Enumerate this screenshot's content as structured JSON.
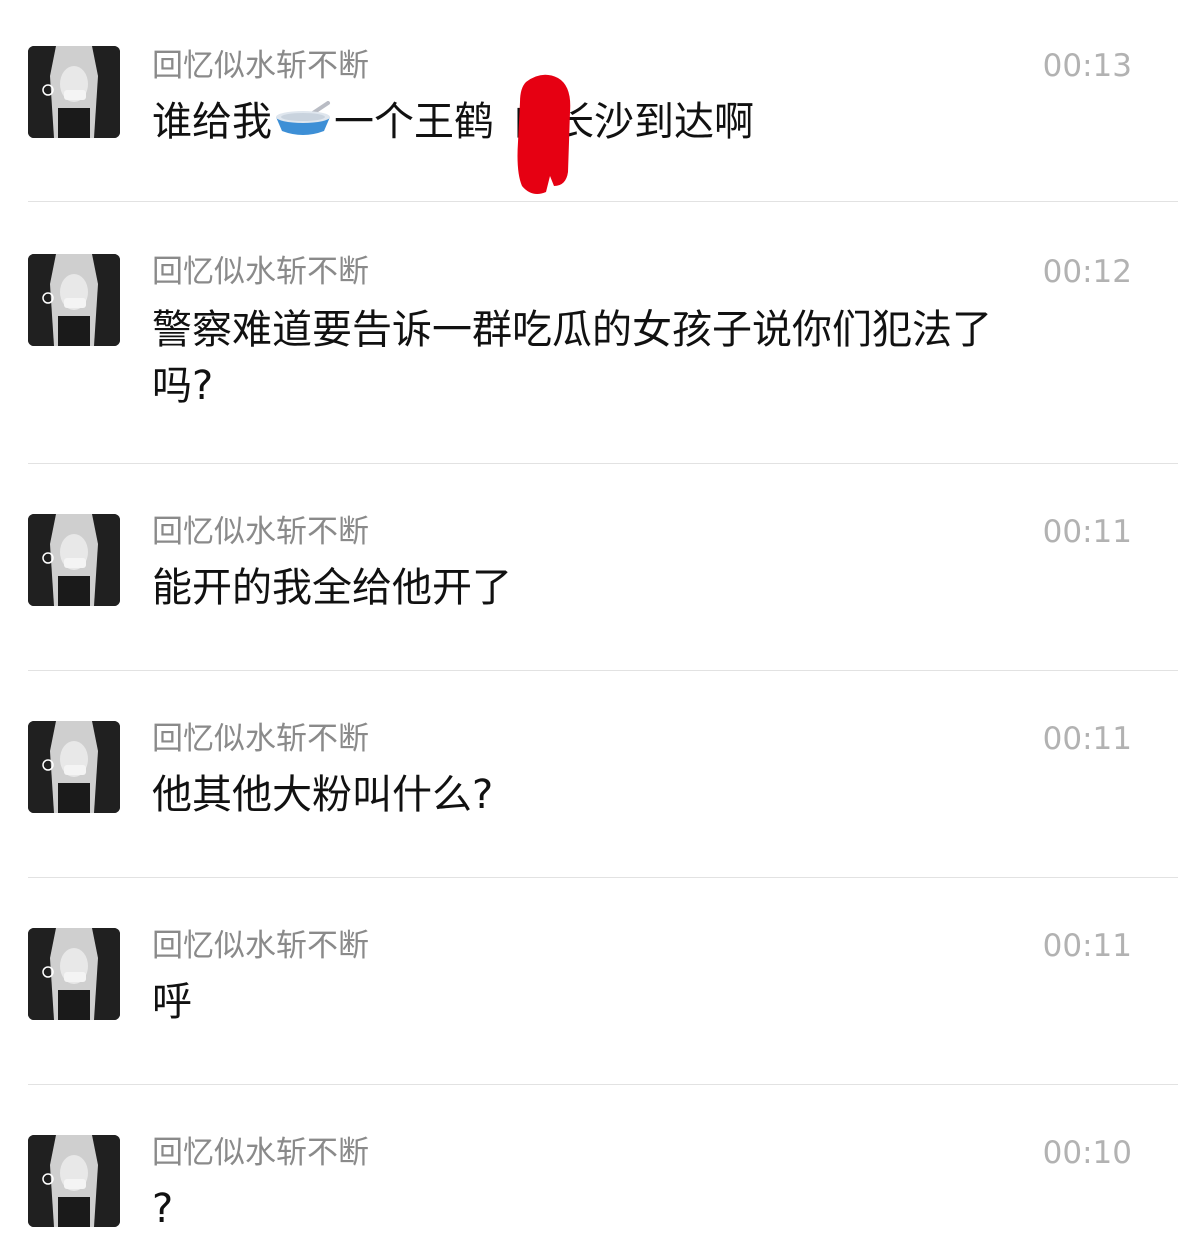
{
  "colors": {
    "name": "#8a8a8a",
    "time": "#b2b2b2",
    "message": "#111111",
    "divider": "#e2e2e2",
    "redaction": "#e60012"
  },
  "messages": [
    {
      "name": "回忆似水斩不断",
      "time": "00:13",
      "text_before_icon": "谁给我",
      "icon": "bowl-spoon-emoji-icon",
      "text_after_icon": "一个王鹤",
      "text_after_redaction": "的长沙到达啊"
    },
    {
      "name": "回忆似水斩不断",
      "time": "00:12",
      "text": "警察难道要告诉一群吃瓜的女孩子说你们犯法了吗?"
    },
    {
      "name": "回忆似水斩不断",
      "time": "00:11",
      "text": "能开的我全给他开了"
    },
    {
      "name": "回忆似水斩不断",
      "time": "00:11",
      "text": "他其他大粉叫什么?"
    },
    {
      "name": "回忆似水斩不断",
      "time": "00:11",
      "text": "呼"
    },
    {
      "name": "回忆似水斩不断",
      "time": "00:10",
      "text": "?"
    }
  ]
}
